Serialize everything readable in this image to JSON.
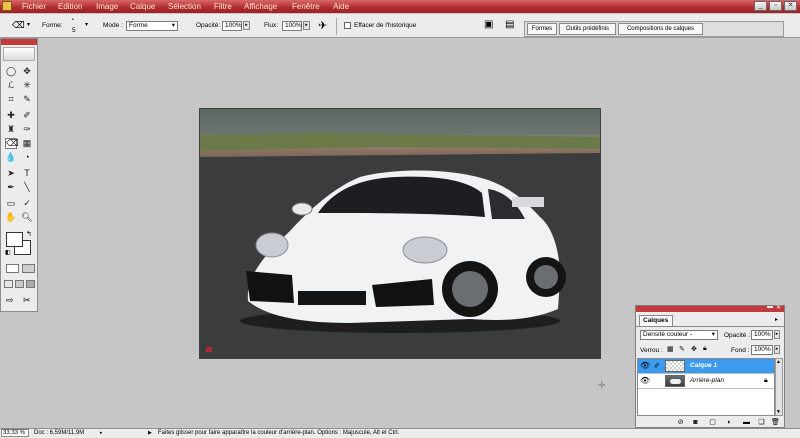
{
  "menubar": {
    "items": [
      "Fichier",
      "Edition",
      "Image",
      "Calque",
      "Sélection",
      "Filtre",
      "Affichage",
      "Fenêtre",
      "Aide"
    ],
    "window_buttons": [
      "_",
      "▫",
      "✕"
    ]
  },
  "options": {
    "forme_label": "Forme:",
    "forme_value": "5",
    "mode_label": "Mode :",
    "mode_value": "Forme",
    "opacite_label": "Opacité:",
    "opacite_value": "100%",
    "flux_label": "Flux:",
    "flux_value": "100%",
    "erase_history_label": "Effacer de l'historique",
    "tabs": [
      "Formes",
      "Outils prédéfinis",
      "Compositions de calques"
    ]
  },
  "layers_panel": {
    "title": "Calques",
    "blend_mode": "Densité couleur -",
    "opacity_label": "Opacité :",
    "opacity_value": "100%",
    "lock_label": "Verrou :",
    "fill_label": "Fond :",
    "fill_value": "100%",
    "layers": [
      {
        "name": "Calque 1",
        "selected": true
      },
      {
        "name": "Arrière-plan",
        "selected": false
      }
    ]
  },
  "status": {
    "zoom": "33,33 %",
    "doc": "Doc : 6,59M/11,9M",
    "hint": "Faites glisser pour faire apparaître la couleur d'arrière-plan. Options : Majuscule, Alt et Ctrl."
  },
  "colors": {
    "accent": "#b02a2d",
    "selected_layer": "#3c9aef",
    "canvas_bg": "#c6c6c6"
  }
}
